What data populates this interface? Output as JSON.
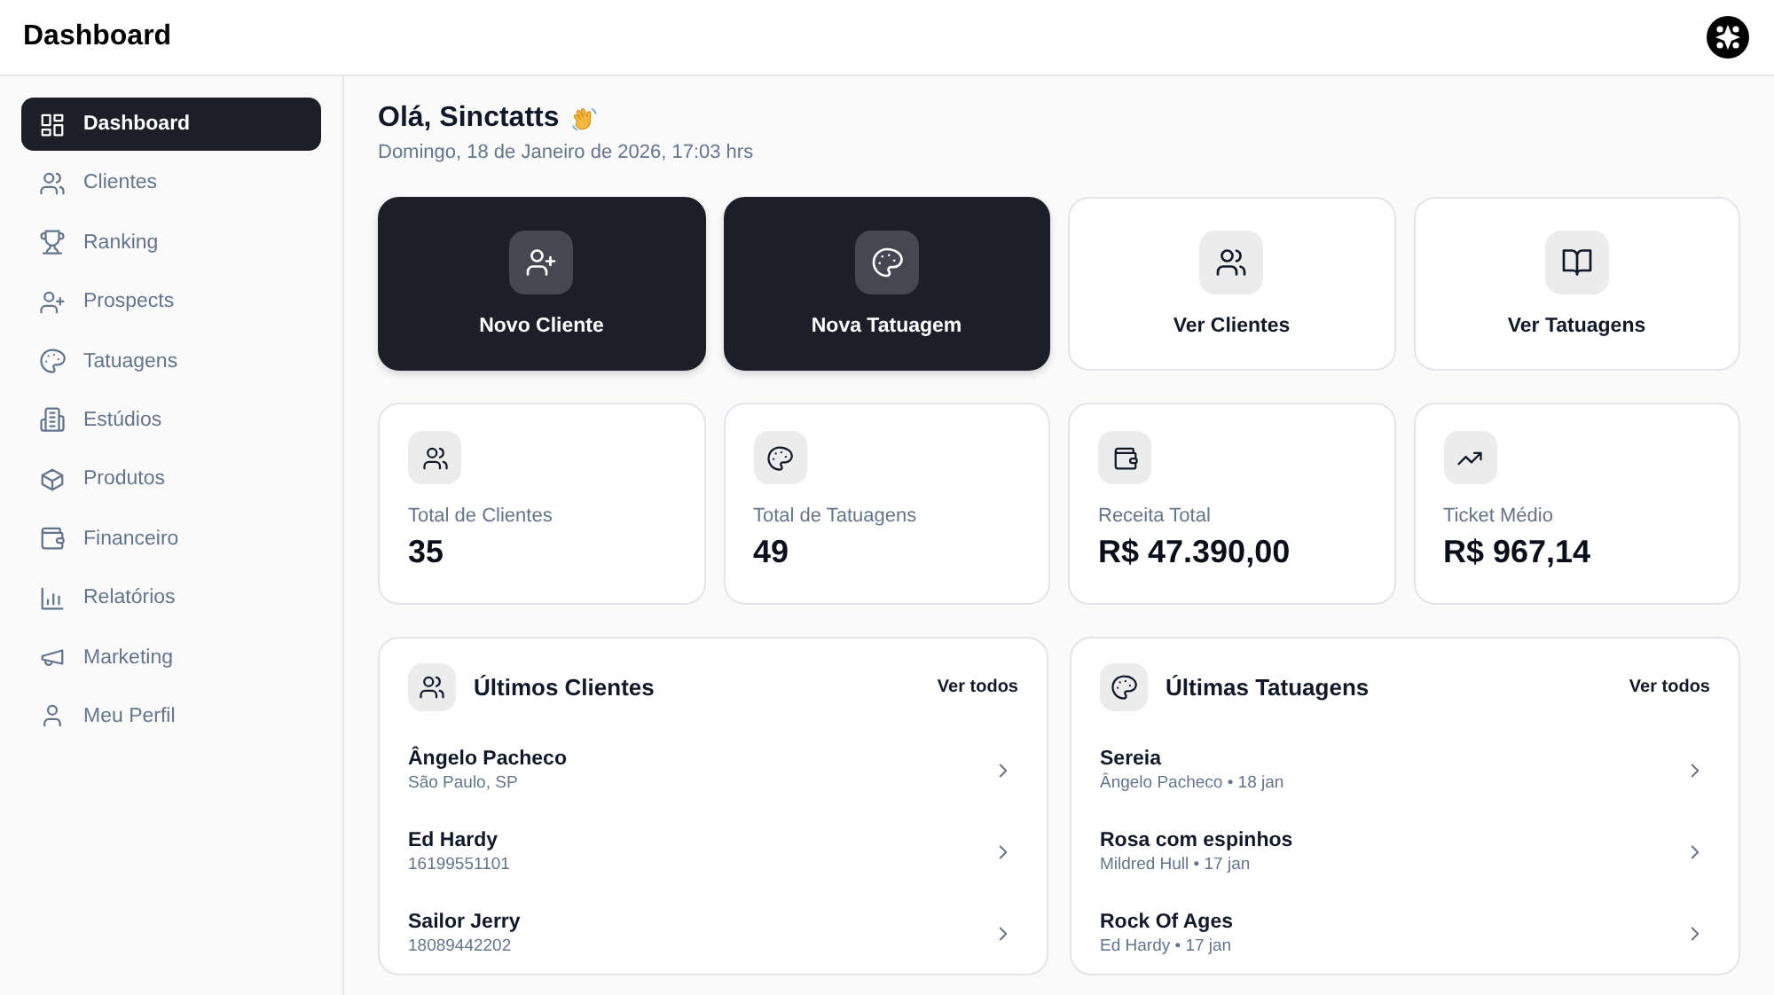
{
  "header": {
    "title": "Dashboard"
  },
  "sidebar": {
    "items": [
      {
        "label": "Dashboard",
        "selected": true
      },
      {
        "label": "Clientes",
        "selected": false
      },
      {
        "label": "Ranking",
        "selected": false
      },
      {
        "label": "Prospects",
        "selected": false
      },
      {
        "label": "Tatuagens",
        "selected": false
      },
      {
        "label": "Estúdios",
        "selected": false
      },
      {
        "label": "Produtos",
        "selected": false
      },
      {
        "label": "Financeiro",
        "selected": false
      },
      {
        "label": "Relatórios",
        "selected": false
      },
      {
        "label": "Marketing",
        "selected": false
      },
      {
        "label": "Meu Perfil",
        "selected": false
      }
    ]
  },
  "greeting": {
    "title": "Olá, Sinctatts",
    "date": "Domingo, 18 de Janeiro de 2026, 17:03 hrs"
  },
  "actions": [
    {
      "label": "Novo Cliente",
      "kind": "primary"
    },
    {
      "label": "Nova Tatuagem",
      "kind": "primary"
    },
    {
      "label": "Ver Clientes",
      "kind": "secondary"
    },
    {
      "label": "Ver Tatuagens",
      "kind": "secondary"
    }
  ],
  "stats": [
    {
      "label": "Total de Clientes",
      "value": "35"
    },
    {
      "label": "Total de Tatuagens",
      "value": "49"
    },
    {
      "label": "Receita Total",
      "value": "R$ 47.390,00"
    },
    {
      "label": "Ticket Médio",
      "value": "R$ 967,14"
    }
  ],
  "panels": [
    {
      "title": "Últimos Clientes",
      "link": "Ver todos",
      "rows": [
        {
          "title": "Ângelo Pacheco",
          "subtitle": "São Paulo, SP"
        },
        {
          "title": "Ed Hardy",
          "subtitle": "16199551101"
        },
        {
          "title": "Sailor Jerry",
          "subtitle": "18089442202"
        }
      ]
    },
    {
      "title": "Últimas Tatuagens",
      "link": "Ver todos",
      "rows": [
        {
          "title": "Sereia",
          "subtitle": "Ângelo Pacheco • 18 jan"
        },
        {
          "title": "Rosa com espinhos",
          "subtitle": "Mildred Hull • 17 jan"
        },
        {
          "title": "Rock Of Ages",
          "subtitle": "Ed Hardy • 17 jan"
        }
      ]
    }
  ]
}
